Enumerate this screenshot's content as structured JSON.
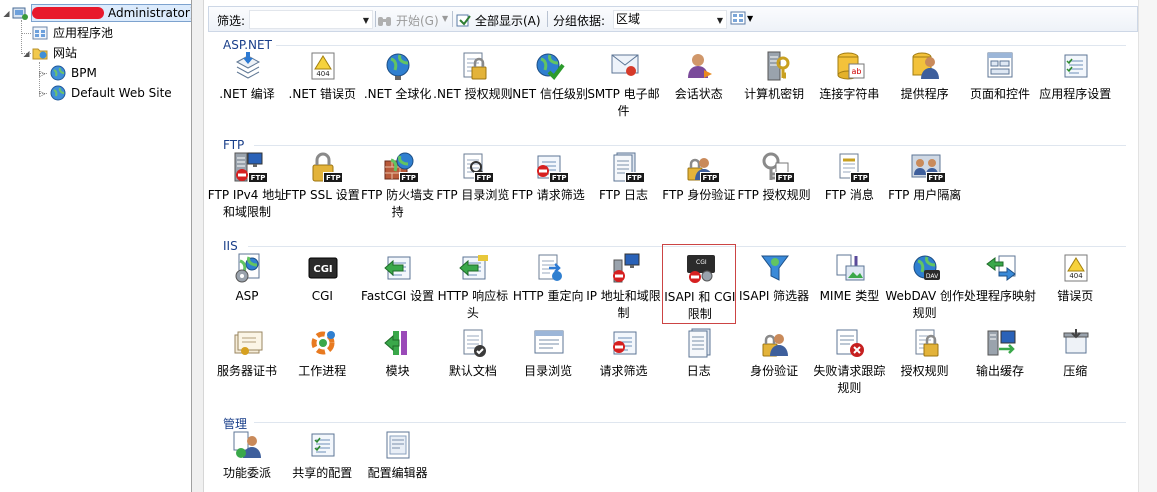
{
  "tree": {
    "root_label": "Administrator)",
    "items": [
      {
        "label": "应用程序池"
      },
      {
        "label": "网站"
      },
      {
        "label": "BPM"
      },
      {
        "label": "Default Web Site"
      }
    ]
  },
  "toolbar": {
    "filter_label": "筛选:",
    "filter_value": "",
    "start_label": "开始(G)",
    "show_all_label": "全部显示(A)",
    "group_by_label": "分组依据:",
    "group_by_value": "区域"
  },
  "groups": [
    {
      "title": "ASP.NET",
      "tiles": [
        {
          "label": ".NET 编译",
          "icon": "compile-icon"
        },
        {
          "label": ".NET 错误页",
          "icon": "error-page-icon"
        },
        {
          "label": ".NET 全球化",
          "icon": "globe-icon"
        },
        {
          "label": ".NET 授权规则",
          "icon": "auth-rules-icon"
        },
        {
          "label": ".NET 信任级别",
          "icon": "trust-level-icon"
        },
        {
          "label": "SMTP 电子邮件",
          "icon": "smtp-icon"
        },
        {
          "label": "会话状态",
          "icon": "session-icon"
        },
        {
          "label": "计算机密钥",
          "icon": "machine-key-icon"
        },
        {
          "label": "连接字符串",
          "icon": "connection-string-icon"
        },
        {
          "label": "提供程序",
          "icon": "providers-icon"
        },
        {
          "label": "页面和控件",
          "icon": "pages-controls-icon"
        },
        {
          "label": "应用程序设置",
          "icon": "app-settings-icon"
        }
      ]
    },
    {
      "title": "FTP",
      "tiles": [
        {
          "label": "FTP IPv4 地址和域限制",
          "icon": "ftp-ip-icon"
        },
        {
          "label": "FTP SSL 设置",
          "icon": "ftp-ssl-icon"
        },
        {
          "label": "FTP 防火墙支持",
          "icon": "ftp-firewall-icon"
        },
        {
          "label": "FTP 目录浏览",
          "icon": "ftp-dir-icon"
        },
        {
          "label": "FTP 请求筛选",
          "icon": "ftp-filter-icon"
        },
        {
          "label": "FTP 日志",
          "icon": "ftp-log-icon"
        },
        {
          "label": "FTP 身份验证",
          "icon": "ftp-auth-icon"
        },
        {
          "label": "FTP 授权规则",
          "icon": "ftp-authz-icon"
        },
        {
          "label": "FTP 消息",
          "icon": "ftp-message-icon"
        },
        {
          "label": "FTP 用户隔离",
          "icon": "ftp-isolation-icon"
        }
      ]
    },
    {
      "title": "IIS",
      "tiles": [
        {
          "label": "ASP",
          "icon": "asp-icon"
        },
        {
          "label": "CGI",
          "icon": "cgi-icon"
        },
        {
          "label": "FastCGI 设置",
          "icon": "fastcgi-icon"
        },
        {
          "label": "HTTP 响应标头",
          "icon": "http-headers-icon"
        },
        {
          "label": "HTTP 重定向",
          "icon": "redirect-icon"
        },
        {
          "label": "IP 地址和域限制",
          "icon": "ip-restrict-icon"
        },
        {
          "label": "ISAPI 和 CGI 限制",
          "icon": "isapi-cgi-icon"
        },
        {
          "label": "ISAPI 筛选器",
          "icon": "isapi-filter-icon"
        },
        {
          "label": "MIME 类型",
          "icon": "mime-icon"
        },
        {
          "label": "WebDAV 创作规则",
          "icon": "webdav-icon"
        },
        {
          "label": "处理程序映射",
          "icon": "handler-icon"
        },
        {
          "label": "错误页",
          "icon": "error-page-icon"
        },
        {
          "label": "服务器证书",
          "icon": "certificate-icon"
        },
        {
          "label": "工作进程",
          "icon": "worker-process-icon"
        },
        {
          "label": "模块",
          "icon": "modules-icon"
        },
        {
          "label": "默认文档",
          "icon": "default-doc-icon"
        },
        {
          "label": "目录浏览",
          "icon": "dir-browse-icon"
        },
        {
          "label": "请求筛选",
          "icon": "request-filter-icon"
        },
        {
          "label": "日志",
          "icon": "log-icon"
        },
        {
          "label": "身份验证",
          "icon": "authentication-icon"
        },
        {
          "label": "失败请求跟踪规则",
          "icon": "failed-trace-icon"
        },
        {
          "label": "授权规则",
          "icon": "authorization-icon"
        },
        {
          "label": "输出缓存",
          "icon": "output-cache-icon"
        },
        {
          "label": "压缩",
          "icon": "compression-icon"
        }
      ]
    },
    {
      "title": "管理",
      "tiles": [
        {
          "label": "功能委派",
          "icon": "delegation-icon"
        },
        {
          "label": "共享的配置",
          "icon": "shared-config-icon"
        },
        {
          "label": "配置编辑器",
          "icon": "config-editor-icon"
        }
      ]
    }
  ],
  "ftp_badge": "FTP",
  "cgi_text": "CGI",
  "err_text": "404",
  "dav_text": "DAV",
  "ab_text": "ab"
}
